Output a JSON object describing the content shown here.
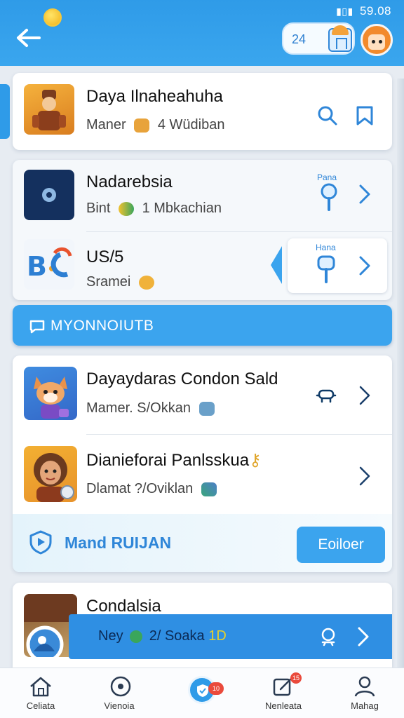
{
  "status_bar": {
    "time": "59.08"
  },
  "header": {
    "coin_count": "24"
  },
  "cards": [
    {
      "title": "Daya Ilnaheahuha",
      "sub_left": "Maner",
      "sub_right": "4 Wüdiban"
    },
    {
      "rows": [
        {
          "title": "Nadarebsia",
          "sub_left": "Bint",
          "sub_right": "1 Mbkachian",
          "action_label": "Pana"
        },
        {
          "title": "US/5",
          "sub_left": "Sramei",
          "action_label": "Hana"
        }
      ]
    }
  ],
  "banner": {
    "label": "MYONNOIUTB"
  },
  "card3": {
    "rows": [
      {
        "title": "Dayaydaras Condon Sald",
        "sub": "Mamer. S/Okkan"
      },
      {
        "title": "Dianieforai Panlsskua",
        "sub": "Dlamat ?/Oviklan"
      }
    ],
    "strip_label": "Mand RUIJAN",
    "follow_label": "Eoiloer"
  },
  "card4": {
    "title": "Condalsia",
    "sub": "Ney",
    "sub_mid": "2/ Soaka",
    "sub_tail": "1D"
  },
  "bottom_nav": {
    "items": [
      {
        "label": "Celiata"
      },
      {
        "label": "Vienoia"
      },
      {
        "label": "Nenleata"
      },
      {
        "label": "Mahag"
      }
    ],
    "fab_badge": "10",
    "nav_badge": "15"
  }
}
